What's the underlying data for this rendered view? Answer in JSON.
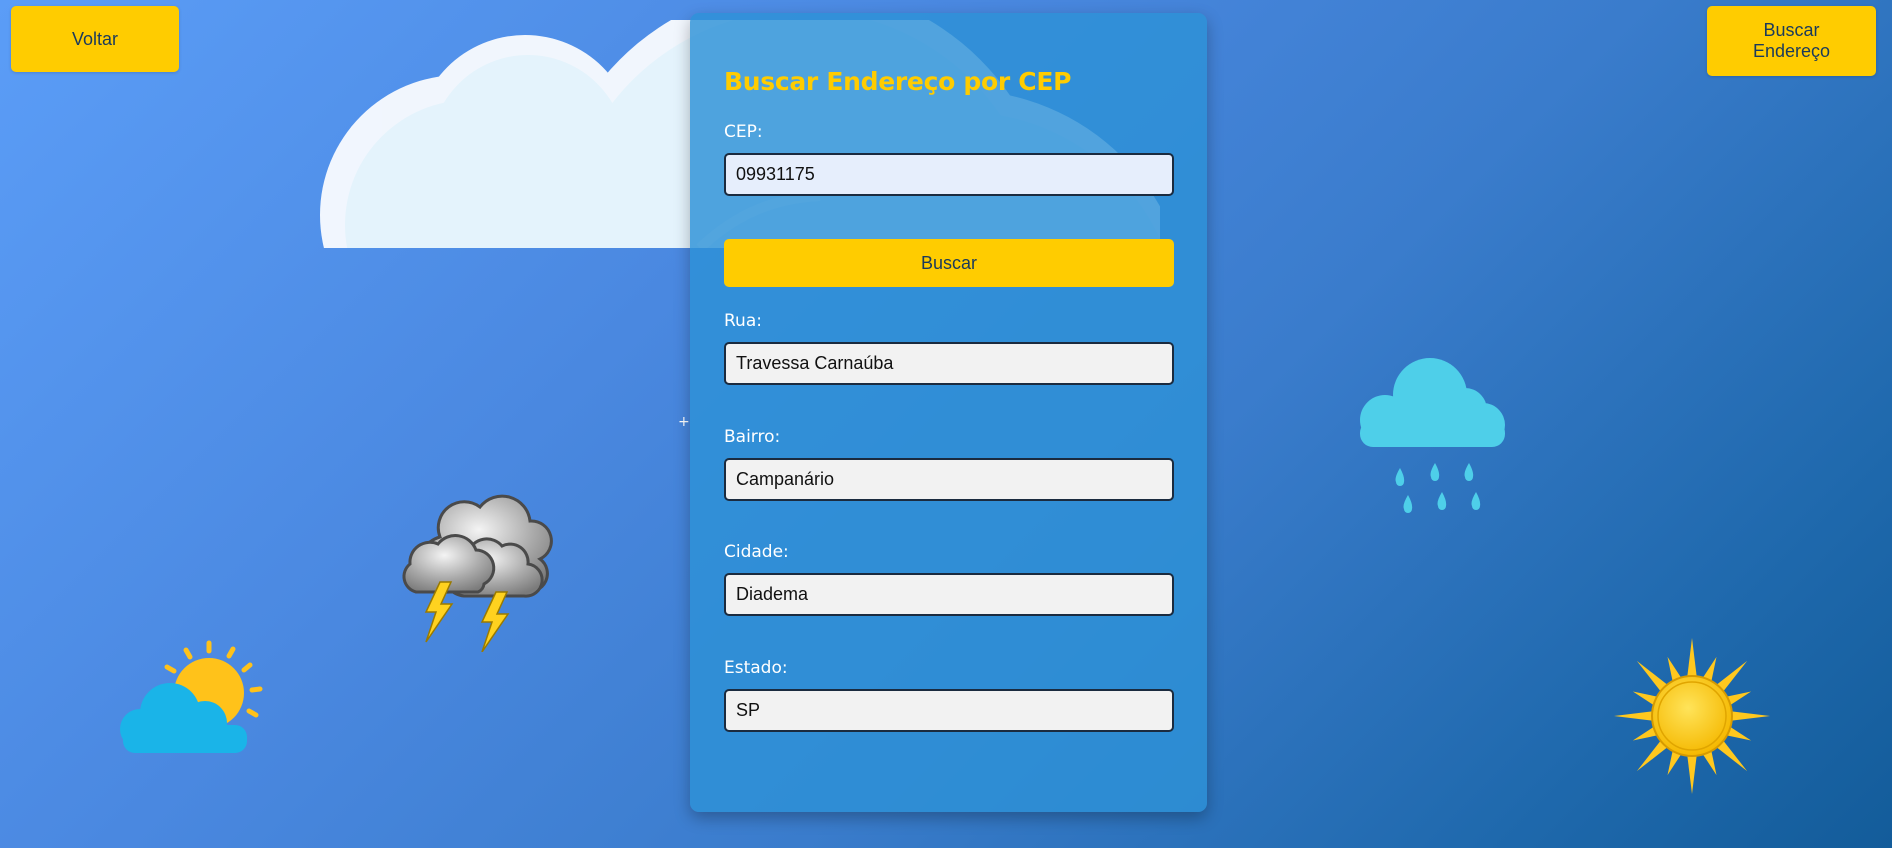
{
  "header": {
    "back_label": "Voltar",
    "address_search_label": "Buscar Endereço"
  },
  "form": {
    "title": "Buscar Endereço por CEP",
    "cep": {
      "label": "CEP:",
      "value": "09931175"
    },
    "search_label": "Buscar",
    "rua": {
      "label": "Rua:",
      "value": "Travessa Carnaúba"
    },
    "bairro": {
      "label": "Bairro:",
      "value": "Campanário"
    },
    "cidade": {
      "label": "Cidade:",
      "value": "Diadema"
    },
    "estado": {
      "label": "Estado:",
      "value": "SP"
    }
  },
  "decorations": {
    "icons": [
      "cloud-icon",
      "thunderstorm-icon",
      "rain-cloud-icon",
      "partly-sunny-icon",
      "sun-icon"
    ],
    "plus_mark": "+"
  },
  "colors": {
    "accent": "#ffcc00",
    "card": "#2d91d7",
    "background_start": "#5b9df7",
    "background_end": "#135c9a"
  }
}
